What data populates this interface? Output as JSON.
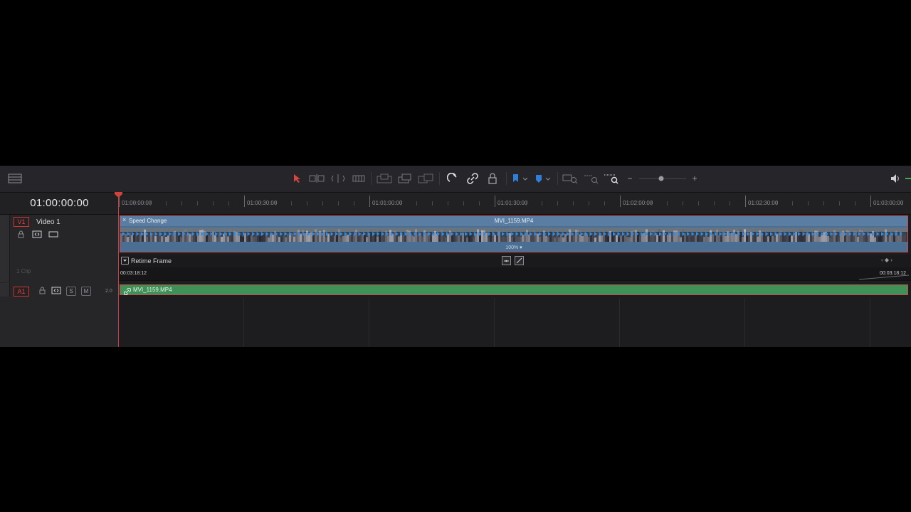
{
  "timecode": "01:00:00:00",
  "ruler": {
    "labels": [
      "01:00:00:00",
      "01:00:30:00",
      "01:01:00:00",
      "01:01:30:00",
      "01:02:00:00",
      "01:02:30:00",
      "01:03:00:00"
    ]
  },
  "tracks": {
    "video": {
      "tag": "V1",
      "name": "Video 1",
      "clip_count": "1 Clip"
    },
    "audio": {
      "tag": "A1",
      "solo": "S",
      "mute": "M",
      "channels": "2.0"
    }
  },
  "video_clip": {
    "effect_label": "Speed Change",
    "name": "MVI_1159.MP4",
    "speed": "100%"
  },
  "retime": {
    "label": "Retime Frame",
    "tc_left": "00:03:18:12",
    "tc_right": "00:03:18:12"
  },
  "audio_clip": {
    "name": "MVI_1159.MP4"
  },
  "colors": {
    "playhead": "#c93e3e",
    "video_clip": "#4a6f93",
    "audio_clip": "#3e9157",
    "selection": "#c84a4a"
  }
}
